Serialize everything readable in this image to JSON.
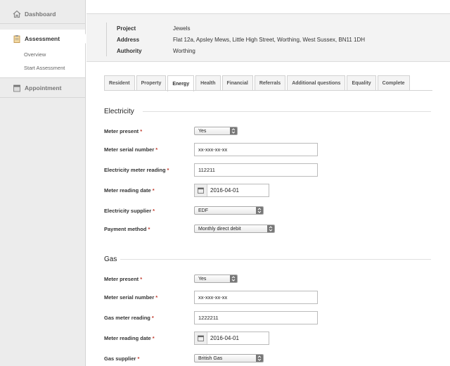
{
  "sidebar": {
    "dashboard": "Dashboard",
    "assessment": "Assessment",
    "overview": "Overview",
    "start_assessment": "Start Assessment",
    "appointment": "Appointment"
  },
  "header": {
    "project_label": "Project",
    "project_value": "Jewels",
    "address_label": "Address",
    "address_value": "Flat 12a, Apsley Mews, Little High Street, Worthing, West Sussex, BN11 1DH",
    "authority_label": "Authority",
    "authority_value": "Worthing"
  },
  "tabs": [
    "Resident",
    "Property",
    "Energy",
    "Health",
    "Financial",
    "Referrals",
    "Additional questions",
    "Equality",
    "Complete"
  ],
  "active_tab": "Energy",
  "electricity": {
    "title": "Electricity",
    "meter_present_label": "Meter present",
    "meter_present_value": "Yes",
    "serial_label": "Meter serial number",
    "serial_value": "xx-xxx-xx-xx",
    "reading_label": "Electricity meter reading",
    "reading_value": "112211",
    "date_label": "Meter reading date",
    "date_value": "2016-04-01",
    "supplier_label": "Electricity supplier",
    "supplier_value": "EDF",
    "payment_label": "Payment method",
    "payment_value": "Monthly direct debit"
  },
  "gas": {
    "title": "Gas",
    "meter_present_label": "Meter present",
    "meter_present_value": "Yes",
    "serial_label": "Meter serial number",
    "serial_value": "xx-xxx-xx-xx",
    "reading_label": "Gas meter reading",
    "reading_value": "1222211",
    "date_label": "Meter reading date",
    "date_value": "2016-04-01",
    "supplier_label": "Gas supplier",
    "supplier_value": "British Gas"
  },
  "required_mark": "*"
}
